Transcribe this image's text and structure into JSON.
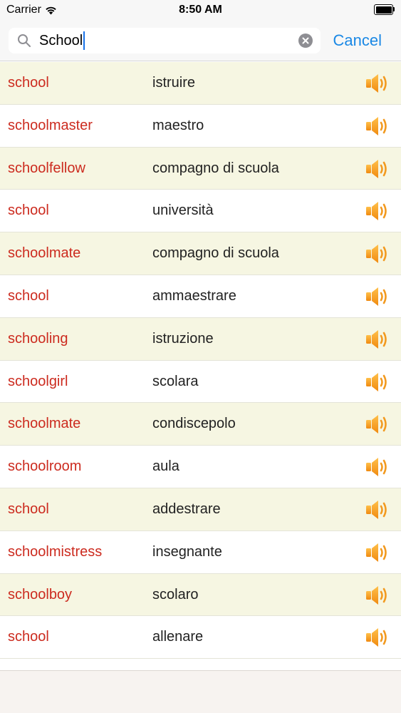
{
  "status_bar": {
    "carrier": "Carrier",
    "time": "8:50 AM"
  },
  "search": {
    "value": "School",
    "cancel_label": "Cancel"
  },
  "colors": {
    "word": "#cc2b1f",
    "accent": "#1a88e5",
    "alt_row": "#f6f6e2",
    "speaker": "#f0a020"
  },
  "results": [
    {
      "word": "school",
      "translation": "istruire"
    },
    {
      "word": "schoolmaster",
      "translation": "maestro"
    },
    {
      "word": "schoolfellow",
      "translation": "compagno di scuola"
    },
    {
      "word": "school",
      "translation": "università"
    },
    {
      "word": "schoolmate",
      "translation": "compagno di scuola"
    },
    {
      "word": "school",
      "translation": "ammaestrare"
    },
    {
      "word": "schooling",
      "translation": "istruzione"
    },
    {
      "word": "schoolgirl",
      "translation": "scolara"
    },
    {
      "word": "schoolmate",
      "translation": "condiscepolo"
    },
    {
      "word": "schoolroom",
      "translation": "aula"
    },
    {
      "word": "school",
      "translation": "addestrare"
    },
    {
      "word": "schoolmistress",
      "translation": "insegnante"
    },
    {
      "word": "schoolboy",
      "translation": "scolaro"
    },
    {
      "word": "school",
      "translation": "allenare"
    }
  ]
}
